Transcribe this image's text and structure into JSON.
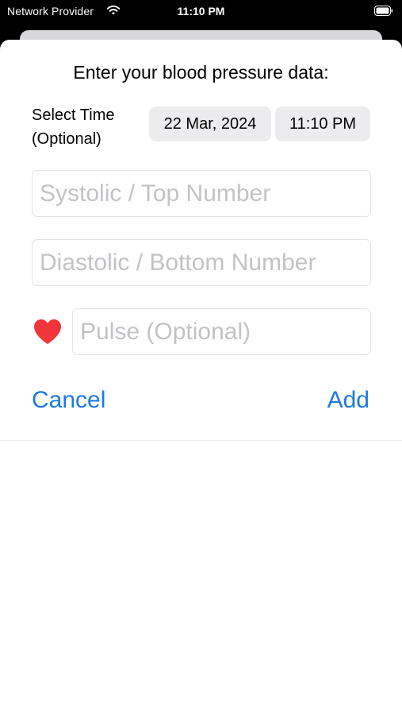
{
  "status_bar": {
    "carrier": "Network Provider",
    "time": "11:10 PM",
    "wifi_icon": "wifi-icon",
    "battery_icon": "battery-icon"
  },
  "form": {
    "title": "Enter your blood pressure data:",
    "time_label_line1": "Select Time",
    "time_label_line2": "(Optional)",
    "date_value": "22 Mar, 2024",
    "time_value": "11:10 PM",
    "systolic_placeholder": "Systolic / Top Number",
    "diastolic_placeholder": "Diastolic / Bottom Number",
    "pulse_placeholder": "Pulse (Optional)",
    "pulse_icon": "heart-icon",
    "cancel_label": "Cancel",
    "add_label": "Add"
  },
  "colors": {
    "accent": "#1b7ae3",
    "heart": "#f0363b",
    "placeholder": "#c3c3c7",
    "pill_background": "#ececee"
  }
}
